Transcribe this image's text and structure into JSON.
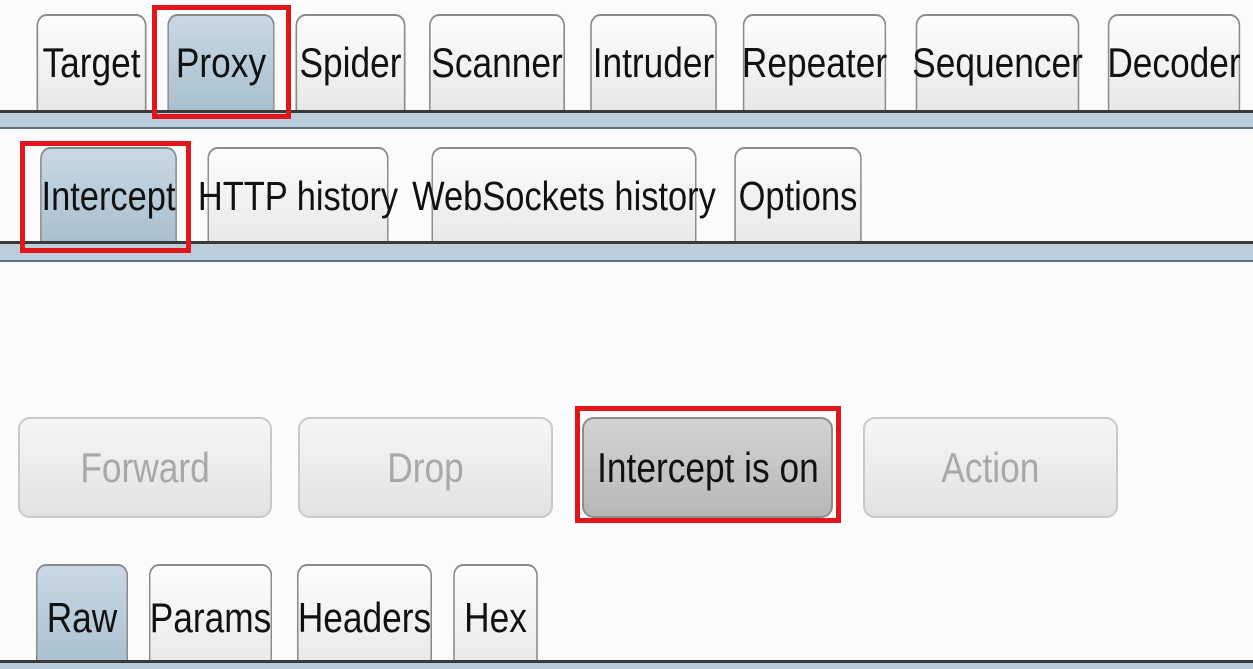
{
  "main_tabs": [
    {
      "label": "Target",
      "selected": false
    },
    {
      "label": "Proxy",
      "selected": true
    },
    {
      "label": "Spider",
      "selected": false
    },
    {
      "label": "Scanner",
      "selected": false
    },
    {
      "label": "Intruder",
      "selected": false
    },
    {
      "label": "Repeater",
      "selected": false
    },
    {
      "label": "Sequencer",
      "selected": false
    },
    {
      "label": "Decoder",
      "selected": false
    }
  ],
  "proxy_tabs": [
    {
      "label": "Intercept",
      "selected": true
    },
    {
      "label": "HTTP history",
      "selected": false
    },
    {
      "label": "WebSockets history",
      "selected": false
    },
    {
      "label": "Options",
      "selected": false
    }
  ],
  "intercept_buttons": {
    "forward": {
      "label": "Forward",
      "enabled": false
    },
    "drop": {
      "label": "Drop",
      "enabled": false
    },
    "intercept_toggle": {
      "label": "Intercept is on",
      "pressed": true
    },
    "action": {
      "label": "Action",
      "enabled": false
    }
  },
  "message_tabs": [
    {
      "label": "Raw",
      "selected": true
    },
    {
      "label": "Params",
      "selected": false
    },
    {
      "label": "Headers",
      "selected": false
    },
    {
      "label": "Hex",
      "selected": false
    }
  ],
  "colors": {
    "highlight": "#e0161b",
    "selected_tab": "#b3c6d5",
    "separator_bar": "#bccddb"
  }
}
